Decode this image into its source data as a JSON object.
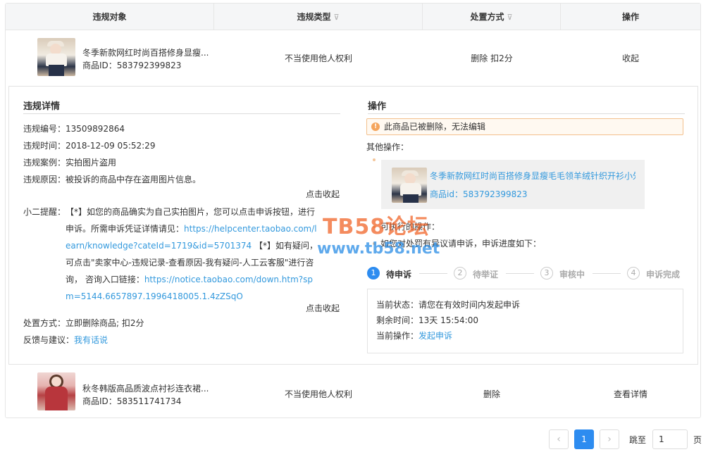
{
  "table": {
    "headers": {
      "target": "违规对象",
      "type": "违规类型",
      "handling": "处置方式",
      "action": "操作"
    },
    "rows": [
      {
        "title": "冬季新款网红时尚百搭修身显瘦...",
        "id_text": "商品ID：583792399823",
        "type": "不当使用他人权利",
        "handling": "删除 扣2分",
        "action": "收起"
      },
      {
        "title": "秋冬韩版高品质波点衬衫连衣裙...",
        "id_text": "商品ID：583511741734",
        "type": "不当使用他人权利",
        "handling": "删除",
        "action": "查看详情"
      }
    ]
  },
  "detail": {
    "left_title": "违规详情",
    "number": "违规编号：13509892864",
    "time": "违规时间：2018-12-09 05:52:29",
    "case": "违规案例：实拍图片盗用",
    "reason": "违规原因：被投诉的商品中存在盗用图片信息。",
    "collapse1": "点击收起",
    "tip_label": "小二提醒：",
    "tip_part1": "【*】如您的商品确实为自己实拍图片，您可以点击申诉按钮，进行申诉。所需申诉凭证详情请见：",
    "tip_link1": "https://helpcenter.taobao.com/learn/knowledge?cateId=1719&id=5701374",
    "tip_part2": " 【*】如有疑问，可点击\"卖家中心-违规记录-查看原因-我有疑问-人工云客服\"进行咨询， 咨询入口链接：",
    "tip_link2": "https://notice.taobao.com/down.htm?spm=5144.6657897.1996418005.1.4zZSqO",
    "collapse2": "点击收起",
    "handling_label": "处置方式：立即删除商品; 扣2分",
    "feedback_label": "反馈与建议：",
    "feedback_link": "我有话说",
    "right_title": "操作",
    "warning": "此商品已被删除，无法编辑",
    "other_ops": "其他操作：",
    "card_title": "冬季新款网红时尚百搭修身显瘦毛毛领羊绒针织开衫小外套",
    "card_id": "商品id：583792399823",
    "available_ops": "可执行的操作：",
    "appeal_note": "如您对处罚有异议请申诉，申诉进度如下：",
    "steps": [
      {
        "num": "1",
        "label": "待申诉"
      },
      {
        "num": "2",
        "label": "待举证"
      },
      {
        "num": "3",
        "label": "审核中"
      },
      {
        "num": "4",
        "label": "申诉完成"
      }
    ],
    "status_current": "当前状态：请您在有效时间内发起申诉",
    "status_remaining": "剩余时间：13天 15:54:00",
    "status_op_label": "当前操作：",
    "status_op_link": "发起申诉"
  },
  "watermark": {
    "line1": "TB58论坛",
    "line2": "www.tb58.net"
  },
  "pagination": {
    "prev": "‹",
    "current": "1",
    "next": "›",
    "jump_label": "跳至",
    "jump_value": "1",
    "page_unit": "页"
  }
}
